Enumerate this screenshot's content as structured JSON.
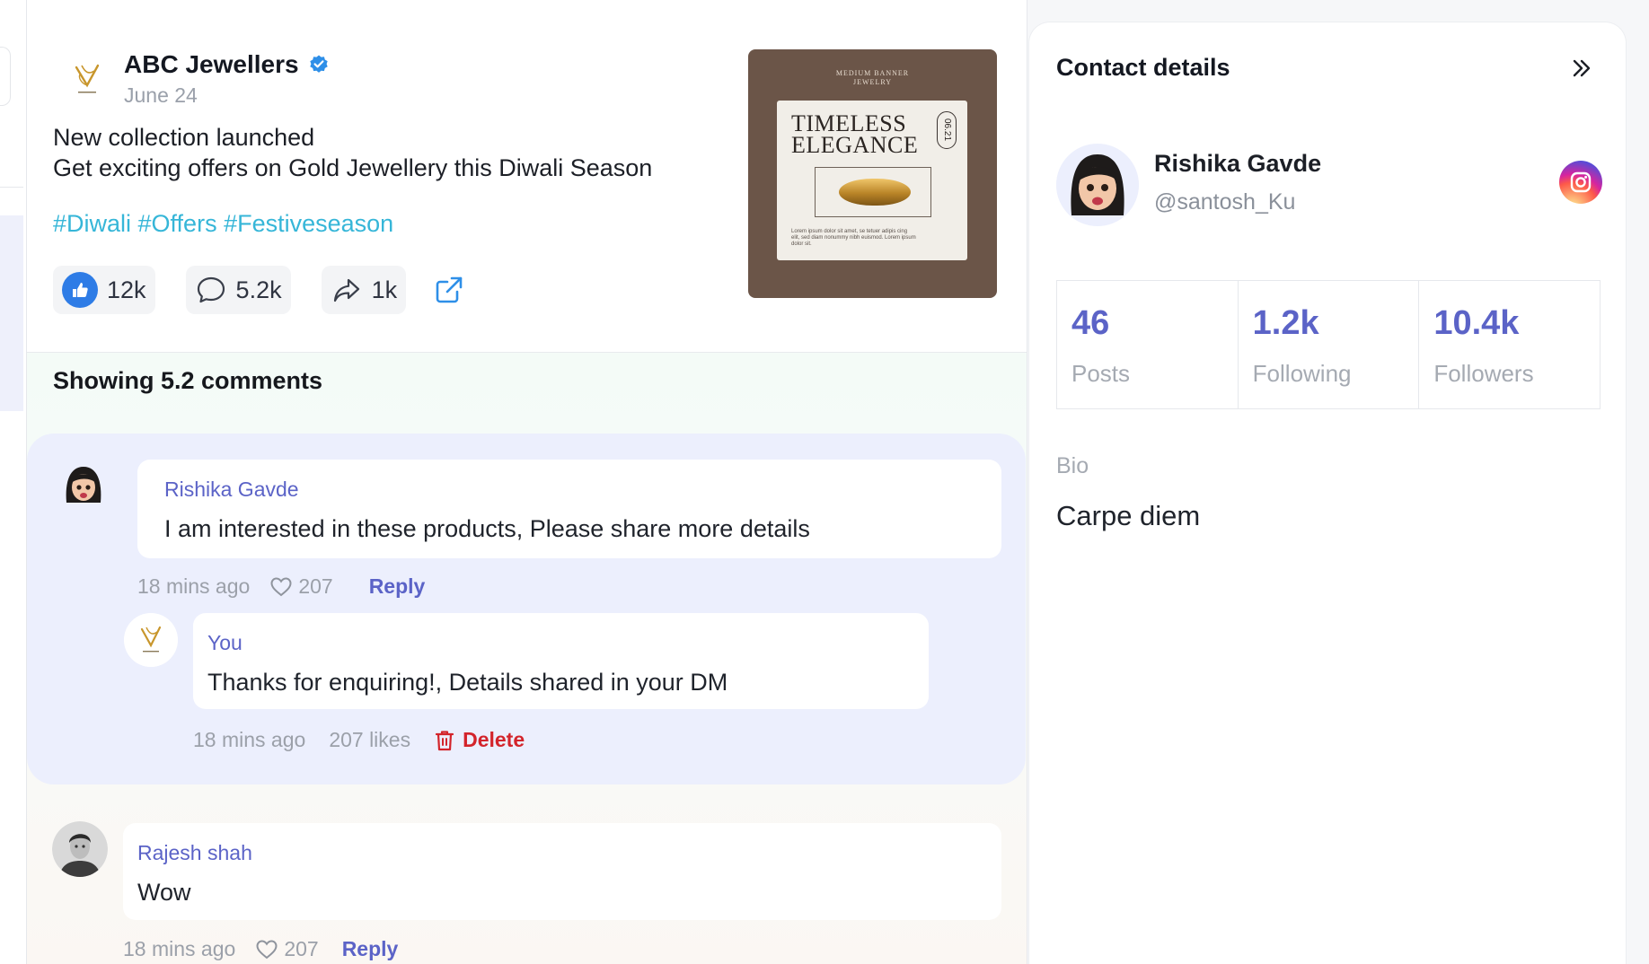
{
  "post": {
    "brand_name": "ABC Jewellers",
    "date": "June 24",
    "text_line1": "New collection launched",
    "text_line2": "Get exciting offers on Gold Jewellery this Diwali Season",
    "hashtags": "#Diwali #Offers #Festiveseason",
    "likes": "12k",
    "comments": "5.2k",
    "shares": "1k",
    "image": {
      "top_line1": "MEDIUM BANNER",
      "top_line2": "JEWELRY",
      "title_line1": "TIMELESS",
      "title_line2": "ELEGANCE",
      "date_tag": "06.21",
      "foot_text": "Lorem ipsum dolor sit amet, se tetuer adipis cing elit, sed diam nonummy nibh euismod. Lorem ipsum dolor sit."
    }
  },
  "comments": {
    "heading": "Showing 5.2 comments",
    "thread": [
      {
        "author": "Rishika Gavde",
        "text": "I am interested in these products, Please share more details",
        "time": "18 mins ago",
        "likes": "207",
        "reply_label": "Reply",
        "reply": {
          "author": "You",
          "text": "Thanks for enquiring!, Details shared in your DM",
          "time": "18 mins ago",
          "likes": "207 likes",
          "delete_label": "Delete"
        }
      },
      {
        "author": "Rajesh shah",
        "text": "Wow",
        "time": "18 mins ago",
        "likes": "207",
        "reply_label": "Reply"
      }
    ]
  },
  "contact": {
    "title": "Contact details",
    "name": "Rishika Gavde",
    "handle": "@santosh_Ku",
    "stats": [
      {
        "value": "46",
        "label": "Posts"
      },
      {
        "value": "1.2k",
        "label": "Following"
      },
      {
        "value": "10.4k",
        "label": "Followers"
      }
    ],
    "bio_label": "Bio",
    "bio": "Carpe diem"
  },
  "colors": {
    "accent": "#5b63c7",
    "hashtag": "#36b6d8",
    "like_blue": "#2e7ce6",
    "delete_red": "#d3242b",
    "thread_bg": "#eceffd"
  },
  "icons": [
    "verified-icon",
    "like-icon",
    "comment-icon",
    "share-icon",
    "external-link-icon",
    "heart-icon",
    "trash-icon",
    "collapse-icon",
    "instagram-icon"
  ]
}
